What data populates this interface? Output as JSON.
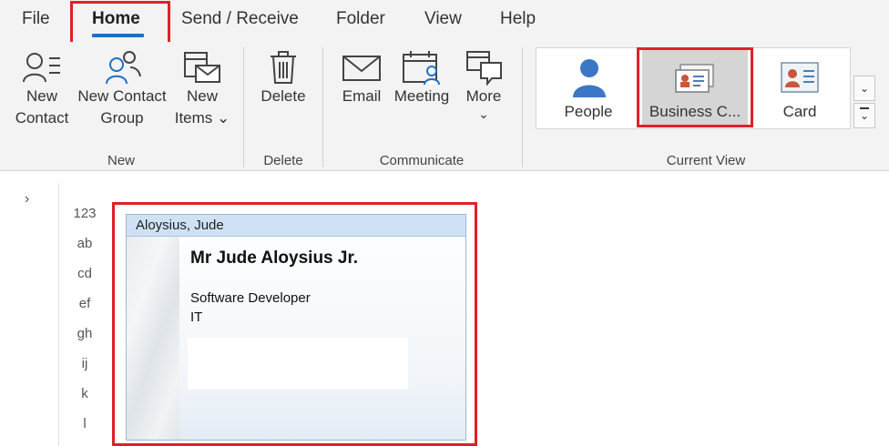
{
  "menu": {
    "tabs": [
      {
        "label": "File"
      },
      {
        "label": "Home"
      },
      {
        "label": "Send / Receive"
      },
      {
        "label": "Folder"
      },
      {
        "label": "View"
      },
      {
        "label": "Help"
      }
    ],
    "active_tab": "Home"
  },
  "ribbon": {
    "groups": {
      "new": {
        "label": "New",
        "new_contact": {
          "line1": "New",
          "line2": "Contact",
          "icon": "new-contact-icon"
        },
        "new_contact_group": {
          "line1": "New Contact",
          "line2": "Group",
          "icon": "contact-group-icon"
        },
        "new_items": {
          "line1": "New",
          "line2": "Items ⌄",
          "icon": "new-items-icon"
        }
      },
      "delete": {
        "label": "Delete",
        "delete": {
          "line1": "Delete",
          "icon": "trash-icon"
        }
      },
      "communicate": {
        "label": "Communicate",
        "email": {
          "line1": "Email",
          "icon": "envelope-icon"
        },
        "meeting": {
          "line1": "Meeting",
          "icon": "calendar-person-icon"
        },
        "more": {
          "line1": "More",
          "line2": "⌄",
          "icon": "more-chat-icon"
        }
      },
      "current_view": {
        "label": "Current View",
        "items": [
          {
            "label": "People",
            "icon": "person-icon"
          },
          {
            "label": "Business C...",
            "icon": "business-card-icon",
            "selected": true
          },
          {
            "label": "Card",
            "icon": "contact-card-icon"
          }
        ],
        "scroll_down": "⌄",
        "more_views": "⌄"
      }
    }
  },
  "index": {
    "expander": "›",
    "letters": [
      "123",
      "ab",
      "cd",
      "ef",
      "gh",
      "ij",
      "k",
      "l"
    ]
  },
  "card": {
    "header": "Aloysius, Jude",
    "full_name": "Mr Jude Aloysius Jr.",
    "job_title": "Software Developer",
    "department": "IT"
  },
  "colors": {
    "accent": "#1e6ec8",
    "highlight_box": "#e0202a",
    "card_header": "#cfe2f5"
  }
}
